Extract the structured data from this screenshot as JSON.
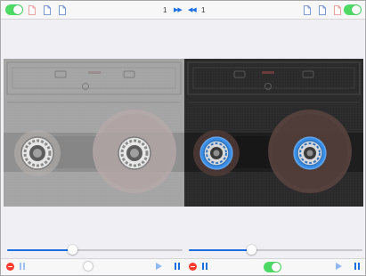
{
  "left_deck": {
    "toggle_on": true,
    "track_number": "1",
    "skip_icon": "fast-forward-icon",
    "position_fraction": 0.37,
    "tape_color": "#a4a4a4"
  },
  "right_deck": {
    "toggle_on": true,
    "track_number": "1",
    "skip_icon": "rewind-icon",
    "position_fraction": 0.36,
    "tape_color": "#2c2c2c",
    "reel_accent": "#3a8ee6"
  },
  "bottom_center_toggle_on": true,
  "colors": {
    "accent": "#1c6fe3",
    "toggle_on": "#4cd964",
    "stop": "#ff3b30"
  }
}
